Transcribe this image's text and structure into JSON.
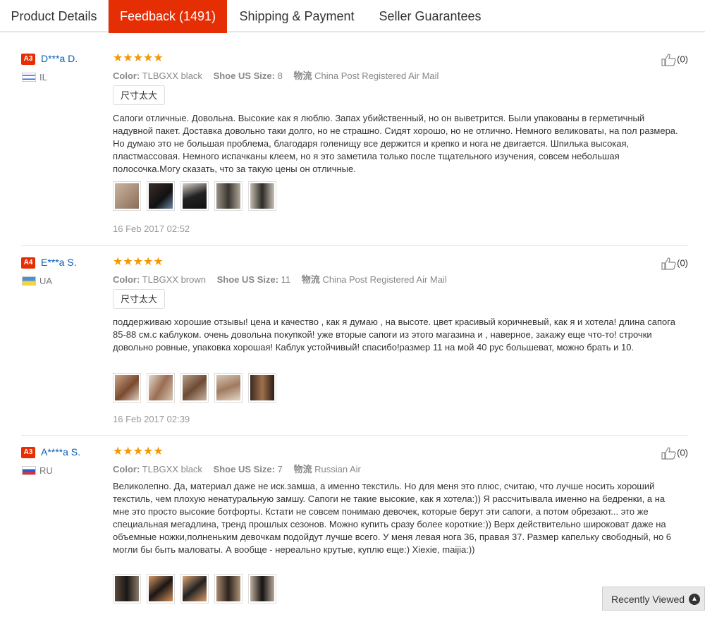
{
  "tabs": [
    {
      "label": "Product Details"
    },
    {
      "label": "Feedback (1491)"
    },
    {
      "label": "Shipping & Payment"
    },
    {
      "label": "Seller Guarantees"
    }
  ],
  "colors": {
    "accent": "#e62e04",
    "link": "#0b5db3",
    "star": "#f39800"
  },
  "reviews": [
    {
      "badge": "A3",
      "name": "D***a D.",
      "country": "IL",
      "stars": "★★★★★",
      "color_label": "Color:",
      "color_value": "TLBGXX black",
      "size_label": "Shoe US Size:",
      "size_value": "8",
      "ship_label": "物流",
      "ship_value": "China Post Registered Air Mail",
      "tag": "尺寸太大",
      "text": "Сапоги отличные. Довольна. Высокие как я люблю. Запах убийственный, но он выветрится. Были упакованы в герметичный надувной пакет. Доставка довольно таки долго, но не страшно. Сидят хорошо, но не отлично. Немного великоваты, на пол размера. Но думаю это не большая проблема, благодаря голенищу все держится и крепко и нога не двигается. Шпилька высокая, пластмассовая. Немного испачканы клеем, но я это заметила только после тщательного изучения, совсем небольшая полосочка.Могу сказать, что за такую цены он отличные.",
      "date": "16 Feb 2017 02:52",
      "likes": "(0)"
    },
    {
      "badge": "A4",
      "name": "E***a S.",
      "country": "UA",
      "stars": "★★★★★",
      "color_label": "Color:",
      "color_value": "TLBGXX brown",
      "size_label": "Shoe US Size:",
      "size_value": "11",
      "ship_label": "物流",
      "ship_value": "China Post Registered Air Mail",
      "tag": "尺寸太大",
      "text": "поддерживаю хорошие отзывы! цена и качество , как я думаю , на высоте. цвет красивый коричневый, как я и хотела! длина сапога 85-88 см.с каблуком. очень довольна покупкой! уже вторые сапоги из этого магазина и , наверное, закажу еще что-то! строчки довольно ровные, упаковка хорошая! Каблук устойчивый! спасибо!размер 11 на мой 40 рус большеват, можно брать и 10.",
      "date": "16 Feb 2017 02:39",
      "likes": "(0)"
    },
    {
      "badge": "A3",
      "name": "A****a S.",
      "country": "RU",
      "stars": "★★★★★",
      "color_label": "Color:",
      "color_value": "TLBGXX black",
      "size_label": "Shoe US Size:",
      "size_value": "7",
      "ship_label": "物流",
      "ship_value": "Russian Air",
      "text": "Великолепно. Да, материал даже не иск.замша, а именно текстиль. Но для меня это плюс, считаю, что лучше носить хороший текстиль, чем плохую ненатуральную замшу. Сапоги не такие высокие, как я хотела:)) Я рассчитывала именно на бедренки, а на мне это просто высокие ботфорты. Кстати не совсем понимаю девочек, которые берут эти сапоги, а потом обрезают... это же специальная мегадлина, тренд прошлых сезонов. Можно купить сразу более короткие:)) Верх действительно широковат даже на объемные ножки,полненьким девочкам подойдут лучше всего. У меня левая нога 36, правая 37. Размер капельку свободный, но 6 могли бы быть маловаты. А вообще - нереально крутые, куплю еще:) Xiexie, maijia:))",
      "likes": "(0)"
    }
  ],
  "recently_viewed": "Recently Viewed"
}
